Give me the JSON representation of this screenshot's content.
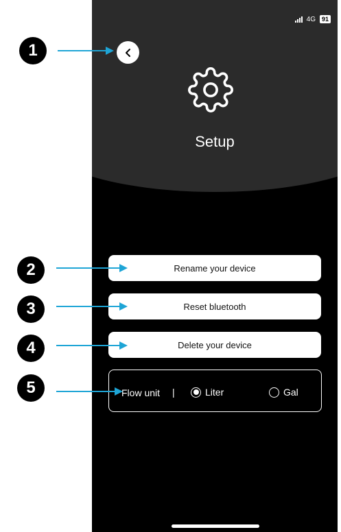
{
  "status_bar": {
    "network": "4G",
    "battery": "91"
  },
  "screen": {
    "title": "Setup"
  },
  "menu": {
    "rename_label": "Rename your device",
    "reset_label": "Reset bluetooth",
    "delete_label": "Delete your device"
  },
  "flow_unit": {
    "label": "Flow unit",
    "separator": "|",
    "options": [
      {
        "label": "Liter",
        "selected": true
      },
      {
        "label": "Gal",
        "selected": false
      }
    ]
  },
  "callouts": [
    "1",
    "2",
    "3",
    "4",
    "5"
  ],
  "colors": {
    "accent": "#1ea5d6",
    "background": "#000000",
    "header": "#2b2b2b"
  },
  "icons": {
    "back": "chevron-left-icon",
    "setup": "gear-icon"
  }
}
